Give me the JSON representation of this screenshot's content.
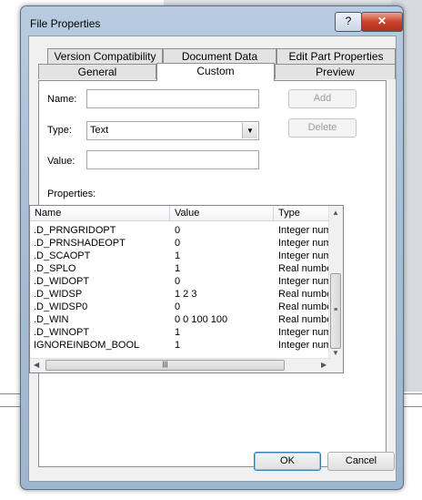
{
  "window": {
    "title": "File Properties",
    "help": "?",
    "close": "✕"
  },
  "tabs": {
    "row1": [
      "Version Compatibility",
      "Document Data",
      "Edit Part Properties"
    ],
    "row2": [
      "General",
      "Custom",
      "Preview"
    ]
  },
  "form": {
    "name_label": "Name:",
    "name_value": "",
    "type_label": "Type:",
    "type_value": "Text",
    "value_label": "Value:",
    "value_value": "",
    "add": "Add",
    "delete": "Delete",
    "properties_label": "Properties:"
  },
  "table": {
    "columns": [
      "Name",
      "Value",
      "Type"
    ],
    "rows": [
      [
        ".D_PRNGRIDOPT",
        "0",
        "Integer number"
      ],
      [
        ".D_PRNSHADEOPT",
        "0",
        "Integer number"
      ],
      [
        ".D_SCAOPT",
        "1",
        "Integer number"
      ],
      [
        ".D_SPLO",
        "1",
        "Real number"
      ],
      [
        ".D_WIDOPT",
        "0",
        "Integer number"
      ],
      [
        ".D_WIDSP",
        "1 2 3",
        "Real number"
      ],
      [
        ".D_WIDSP0",
        "0",
        "Real number"
      ],
      [
        ".D_WIN",
        "0 0 100 100",
        "Real number"
      ],
      [
        ".D_WINOPT",
        "1",
        "Integer number"
      ],
      [
        "IGNOREINBOM_BOOL",
        "1",
        "Integer number"
      ]
    ]
  },
  "footer": {
    "ok": "OK",
    "cancel": "Cancel"
  }
}
